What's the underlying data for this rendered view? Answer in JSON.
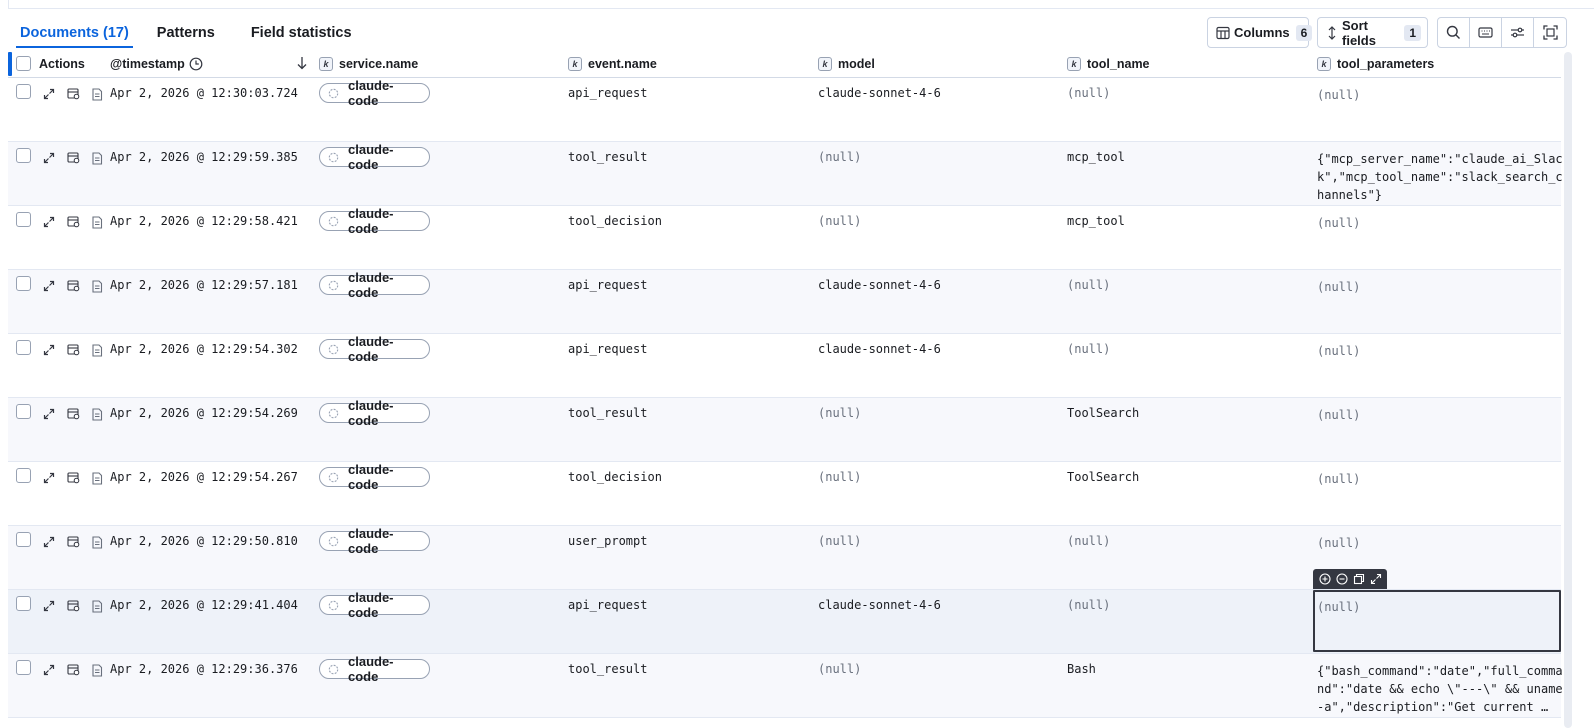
{
  "tabs": [
    {
      "label": "Documents (17)",
      "active": true
    },
    {
      "label": "Patterns",
      "active": false
    },
    {
      "label": "Field statistics",
      "active": false
    }
  ],
  "toolbar": {
    "columns_label": "Columns",
    "columns_count": "6",
    "sort_label": "Sort fields",
    "sort_count": "1",
    "icons": [
      "search-icon",
      "keyboard-icon",
      "display-settings-icon",
      "fullscreen-icon"
    ]
  },
  "columns": {
    "actions": "Actions",
    "timestamp": "@timestamp",
    "service": "service.name",
    "event": "event.name",
    "model": "model",
    "tool_name": "tool_name",
    "tool_parameters": "tool_parameters",
    "field_type_badge": "k"
  },
  "rows": [
    {
      "timestamp": "Apr 2, 2026 @ 12:30:03.724",
      "service": "claude-code",
      "event": "api_request",
      "model": "claude-sonnet-4-6",
      "tool_name": "(null)",
      "tool_parameters": "(null)"
    },
    {
      "timestamp": "Apr 2, 2026 @ 12:29:59.385",
      "service": "claude-code",
      "event": "tool_result",
      "model": "(null)",
      "tool_name": "mcp_tool",
      "tool_parameters": "{\"mcp_server_name\":\"claude_ai_Slack\",\"mcp_tool_name\":\"slack_search_channels\"}"
    },
    {
      "timestamp": "Apr 2, 2026 @ 12:29:58.421",
      "service": "claude-code",
      "event": "tool_decision",
      "model": "(null)",
      "tool_name": "mcp_tool",
      "tool_parameters": "(null)"
    },
    {
      "timestamp": "Apr 2, 2026 @ 12:29:57.181",
      "service": "claude-code",
      "event": "api_request",
      "model": "claude-sonnet-4-6",
      "tool_name": "(null)",
      "tool_parameters": "(null)"
    },
    {
      "timestamp": "Apr 2, 2026 @ 12:29:54.302",
      "service": "claude-code",
      "event": "api_request",
      "model": "claude-sonnet-4-6",
      "tool_name": "(null)",
      "tool_parameters": "(null)"
    },
    {
      "timestamp": "Apr 2, 2026 @ 12:29:54.269",
      "service": "claude-code",
      "event": "tool_result",
      "model": "(null)",
      "tool_name": "ToolSearch",
      "tool_parameters": "(null)"
    },
    {
      "timestamp": "Apr 2, 2026 @ 12:29:54.267",
      "service": "claude-code",
      "event": "tool_decision",
      "model": "(null)",
      "tool_name": "ToolSearch",
      "tool_parameters": "(null)"
    },
    {
      "timestamp": "Apr 2, 2026 @ 12:29:50.810",
      "service": "claude-code",
      "event": "user_prompt",
      "model": "(null)",
      "tool_name": "(null)",
      "tool_parameters": "(null)"
    },
    {
      "timestamp": "Apr 2, 2026 @ 12:29:41.404",
      "service": "claude-code",
      "event": "api_request",
      "model": "claude-sonnet-4-6",
      "tool_name": "(null)",
      "tool_parameters": "(null)"
    },
    {
      "timestamp": "Apr 2, 2026 @ 12:29:36.376",
      "service": "claude-code",
      "event": "tool_result",
      "model": "(null)",
      "tool_name": "Bash",
      "tool_parameters": "{\"bash_command\":\"date\",\"full_command\":\"date && echo \\\"---\\\" && uname -a\",\"description\":\"Get current …"
    }
  ],
  "colors": {
    "accent": "#0b64dd",
    "border": "#d3dae6",
    "null_text": "#69707d"
  }
}
